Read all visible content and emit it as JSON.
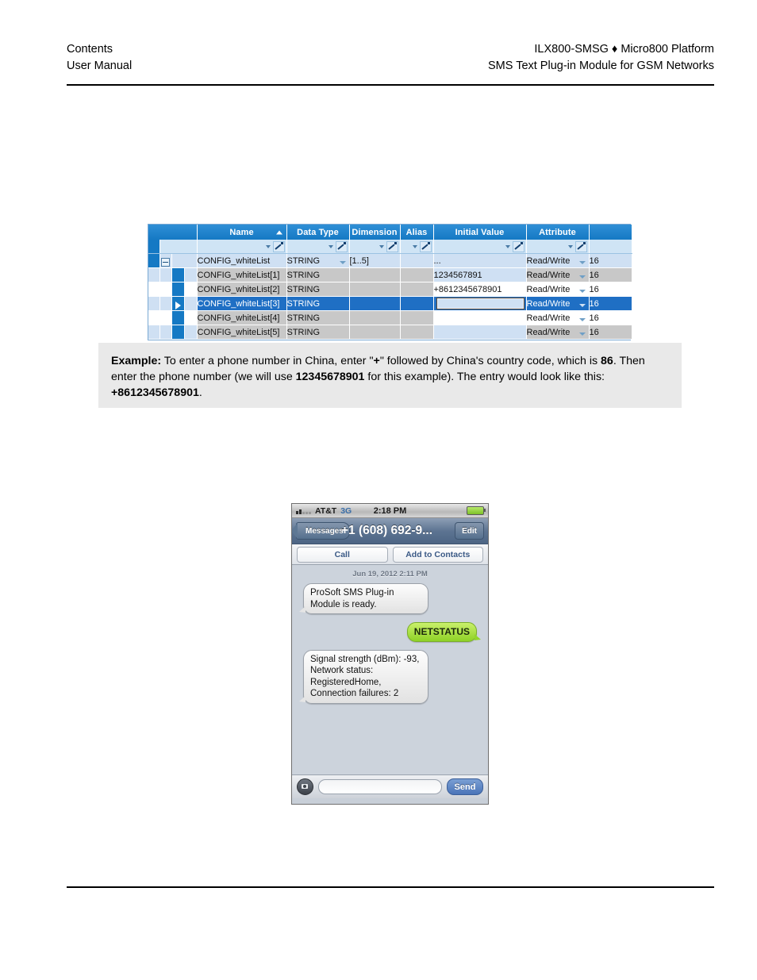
{
  "header": {
    "left_line1": "Contents",
    "left_line2": "User Manual",
    "right_line1": "ILX800-SMSG ♦ Micro800 Platform",
    "right_line2": "SMS Text Plug-in Module for GSM Networks"
  },
  "grid": {
    "columns": [
      "Name",
      "Data Type",
      "Dimension",
      "Alias",
      "Initial Value",
      "Attribute"
    ],
    "rows": [
      {
        "name": "CONFIG_whiteList",
        "data_type": "STRING",
        "dimension": "[1..5]",
        "alias": "",
        "initial_value": "...",
        "attribute": "Read/Write",
        "last": "16"
      },
      {
        "name": "CONFIG_whiteList[1]",
        "data_type": "STRING",
        "dimension": "",
        "alias": "",
        "initial_value": "1234567891",
        "attribute": "Read/Write",
        "last": "16"
      },
      {
        "name": "CONFIG_whiteList[2]",
        "data_type": "STRING",
        "dimension": "",
        "alias": "",
        "initial_value": "+8612345678901",
        "attribute": "Read/Write",
        "last": "16"
      },
      {
        "name": "CONFIG_whiteList[3]",
        "data_type": "STRING",
        "dimension": "",
        "alias": "",
        "initial_value": "",
        "attribute": "Read/Write",
        "last": "16"
      },
      {
        "name": "CONFIG_whiteList[4]",
        "data_type": "STRING",
        "dimension": "",
        "alias": "",
        "initial_value": "",
        "attribute": "Read/Write",
        "last": "16"
      },
      {
        "name": "CONFIG_whiteList[5]",
        "data_type": "STRING",
        "dimension": "",
        "alias": "",
        "initial_value": "",
        "attribute": "Read/Write",
        "last": "16"
      }
    ]
  },
  "callout": {
    "label": "Example:",
    "text_part1": " To enter a phone number in China, enter \"",
    "plus": "+",
    "text_part2": "\" followed by China's country code, which is ",
    "country_code": "86",
    "text_part3": ". Then enter the phone number (we will use ",
    "number": "12345678901",
    "text_part4": " for this example). The entry would look like this: ",
    "full_number": "+8612345678901",
    "text_part5": "."
  },
  "phone": {
    "status": {
      "carrier": "AT&T",
      "network": "3G",
      "time": "2:18 PM"
    },
    "nav": {
      "back_label": "Messages",
      "title": "+1 (608) 692-9...",
      "edit_label": "Edit"
    },
    "actions": {
      "call_label": "Call",
      "add_contacts_label": "Add to Contacts"
    },
    "timestamp": "Jun 19, 2012 2:11 PM",
    "messages": [
      {
        "direction": "in",
        "text": "ProSoft SMS Plug-in Module is ready."
      },
      {
        "direction": "out",
        "text": "NETSTATUS"
      },
      {
        "direction": "in",
        "text": "Signal strength (dBm): -93, Network status: RegisteredHome, Connection failures: 2"
      }
    ],
    "compose": {
      "field_value": "",
      "field_placeholder": "",
      "send_label": "Send"
    }
  },
  "colors": {
    "grid_header_blue": "#1579c4",
    "grid_selection_blue": "#1f6fc4",
    "callout_bg": "#e9e9e9",
    "bubble_out_green": "#8ed226",
    "send_blue": "#4a74b8"
  }
}
